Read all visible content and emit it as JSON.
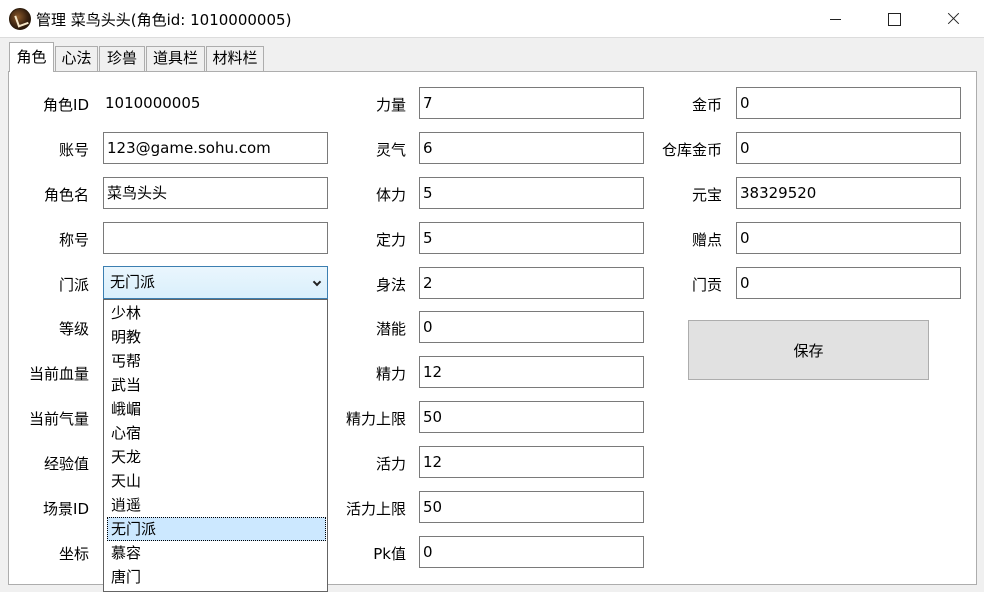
{
  "window": {
    "title": "管理 菜鸟头头(角色id: 1010000005)"
  },
  "tabs": [
    {
      "label": "角色"
    },
    {
      "label": "心法"
    },
    {
      "label": "珍兽"
    },
    {
      "label": "道具栏"
    },
    {
      "label": "材料栏"
    }
  ],
  "col1": {
    "role_id_label": "角色ID",
    "role_id_value": "1010000005",
    "account_label": "账号",
    "account_value": "123@game.sohu.com",
    "role_name_label": "角色名",
    "role_name_value": "菜鸟头头",
    "title_label": "称号",
    "title_value": "",
    "sect_label": "门派",
    "sect_value": "无门派",
    "level_label": "等级",
    "hp_label": "当前血量",
    "mp_label": "当前气量",
    "exp_label": "经验值",
    "scene_label": "场景ID",
    "coord_label": "坐标"
  },
  "sect_options": [
    "少林",
    "明教",
    "丐帮",
    "武当",
    "峨嵋",
    "心宿",
    "天龙",
    "天山",
    "逍遥",
    "无门派",
    "慕容",
    "唐门"
  ],
  "col2": {
    "str_label": "力量",
    "str_value": "7",
    "spi_label": "灵气",
    "spi_value": "6",
    "con_label": "体力",
    "con_value": "5",
    "int_label": "定力",
    "int_value": "5",
    "dex_label": "身法",
    "dex_value": "2",
    "pot_label": "潜能",
    "pot_value": "0",
    "energy_label": "精力",
    "energy_value": "12",
    "energy_max_label": "精力上限",
    "energy_max_value": "50",
    "vigor_label": "活力",
    "vigor_value": "12",
    "vigor_max_label": "活力上限",
    "vigor_max_value": "50",
    "pk_label": "Pk值",
    "pk_value": "0"
  },
  "col3": {
    "gold_label": "金币",
    "gold_value": "0",
    "bank_gold_label": "仓库金币",
    "bank_gold_value": "0",
    "yuanbao_label": "元宝",
    "yuanbao_value": "38329520",
    "gift_label": "赠点",
    "gift_value": "0",
    "contrib_label": "门贡",
    "contrib_value": "0"
  },
  "save_label": "保存"
}
